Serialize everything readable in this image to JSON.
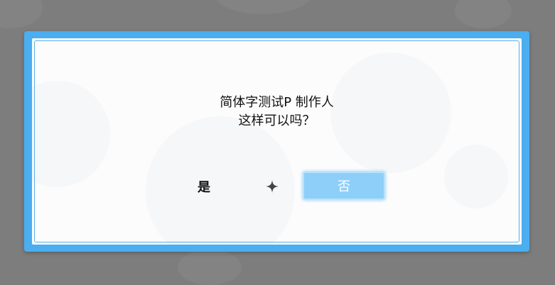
{
  "dialog": {
    "message_line_1": "简体字测试P 制作人",
    "message_line_2": "这样可以吗？",
    "yes_label": "是",
    "no_label": "否",
    "selector_icon": "sparkle-icon"
  },
  "colors": {
    "frame": "#4aaef0",
    "panel": "#fcfcfc",
    "selected_button": "#8ecff9",
    "text": "#111111"
  }
}
